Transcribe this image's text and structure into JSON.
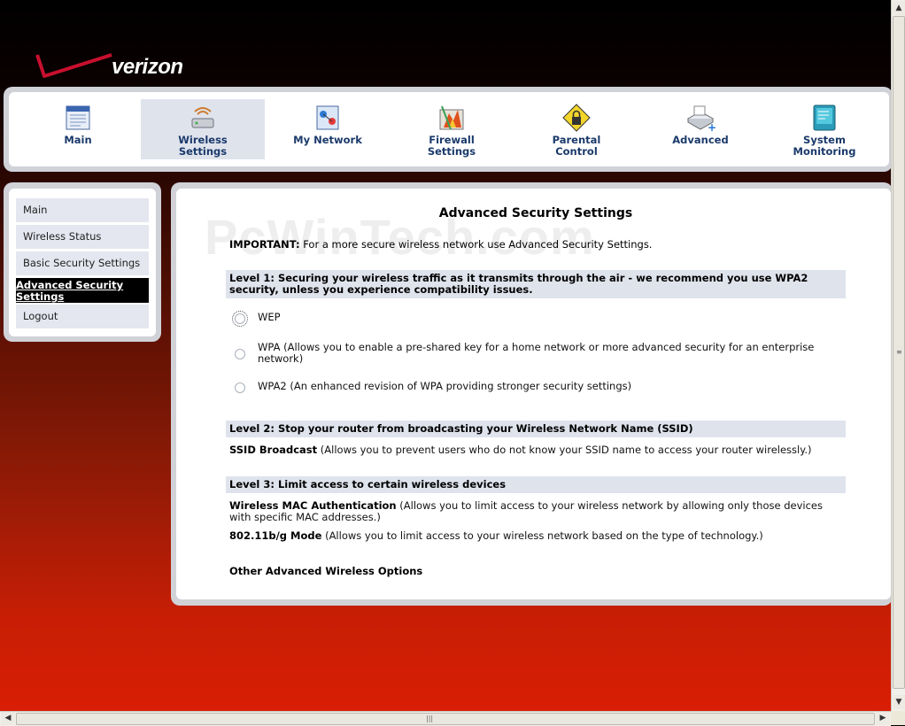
{
  "brand": {
    "logo_text": "verizon"
  },
  "nav": [
    {
      "label": "Main",
      "icon": "main-doc-icon",
      "active": false
    },
    {
      "label": "Wireless Settings",
      "icon": "wireless-router-icon",
      "active": true
    },
    {
      "label": "My Network",
      "icon": "my-network-icon",
      "active": false
    },
    {
      "label": "Firewall Settings",
      "icon": "firewall-icon",
      "active": false
    },
    {
      "label": "Parental Control",
      "icon": "padlock-warning-icon",
      "active": false
    },
    {
      "label": "Advanced",
      "icon": "advanced-scanner-icon",
      "active": false
    },
    {
      "label": "System Monitoring",
      "icon": "system-monitor-icon",
      "active": false
    }
  ],
  "sidebar": {
    "items": [
      {
        "label": "Main"
      },
      {
        "label": "Wireless Status"
      },
      {
        "label": "Basic Security Settings"
      },
      {
        "label": "Advanced Security Settings",
        "active": true
      },
      {
        "label": "Logout"
      }
    ]
  },
  "main": {
    "title": "Advanced Security Settings",
    "watermark": "PcWinTech.com",
    "important_label": "IMPORTANT:",
    "important_text": " For a more secure wireless network use Advanced Security Settings.",
    "level1": {
      "header": "Level 1: Securing your wireless traffic as it transmits through the air - we recommend you use WPA2 security, unless you experience compatibility issues.",
      "options": [
        {
          "label": "WEP"
        },
        {
          "label": "WPA (Allows you to enable a pre-shared key for a home network or more advanced security for an enterprise network)"
        },
        {
          "label": "WPA2 (An enhanced revision of WPA providing stronger security settings)"
        }
      ]
    },
    "level2": {
      "header": "Level 2: Stop your router from broadcasting your Wireless Network Name (SSID)",
      "ssid_label": "SSID Broadcast",
      "ssid_text": " (Allows you to prevent users who do not know your SSID name to access your router wirelessly.)"
    },
    "level3": {
      "header": "Level 3: Limit access to certain wireless devices",
      "mac_label": "Wireless MAC Authentication",
      "mac_text": " (Allows you to limit access to your wireless network by allowing only those devices with specific MAC addresses.)",
      "mode_label": "802.11b/g Mode",
      "mode_text": " (Allows you to limit access to your wireless network based on the type of technology.)"
    },
    "other_label": "Other Advanced Wireless Options"
  },
  "colors": {
    "accent": "#1b3a6b",
    "nav_active": "#dfe3ec",
    "header_bg": "#dfe3ec",
    "brand_red": "#c81e05"
  }
}
